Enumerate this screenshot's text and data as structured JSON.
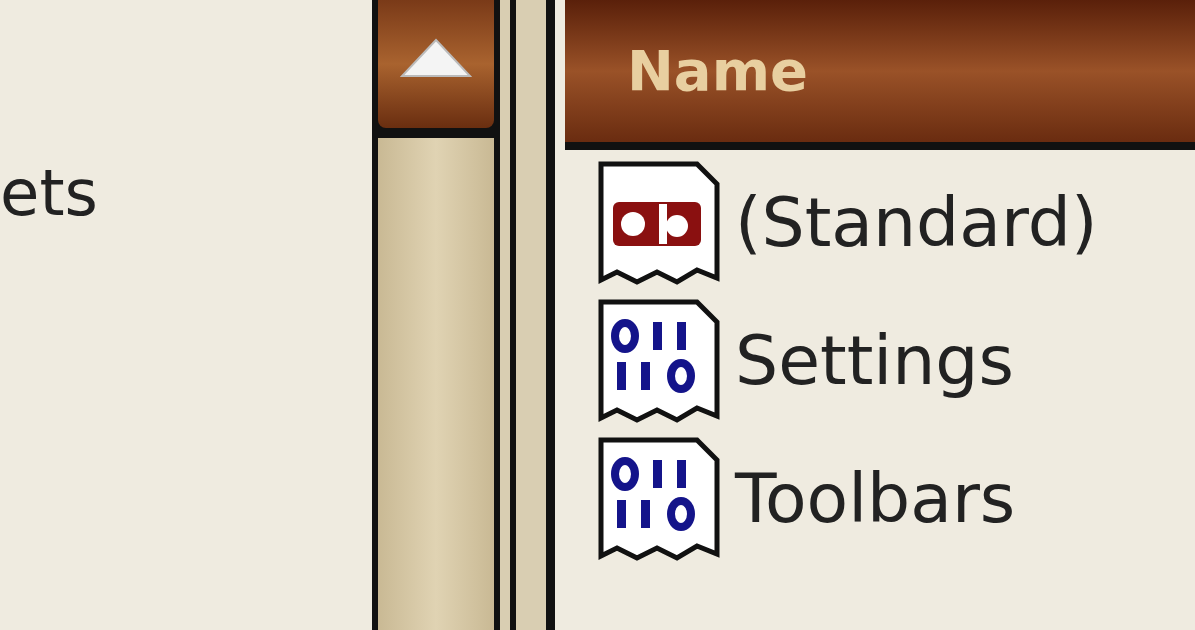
{
  "tree": {
    "items": [
      {
        "label": "ets"
      }
    ]
  },
  "values": {
    "columns": [
      "Name"
    ],
    "rows": [
      {
        "kind": "string",
        "name": "(Standard)"
      },
      {
        "kind": "binary",
        "name": "Settings"
      },
      {
        "kind": "binary",
        "name": "Toolbars"
      }
    ]
  }
}
